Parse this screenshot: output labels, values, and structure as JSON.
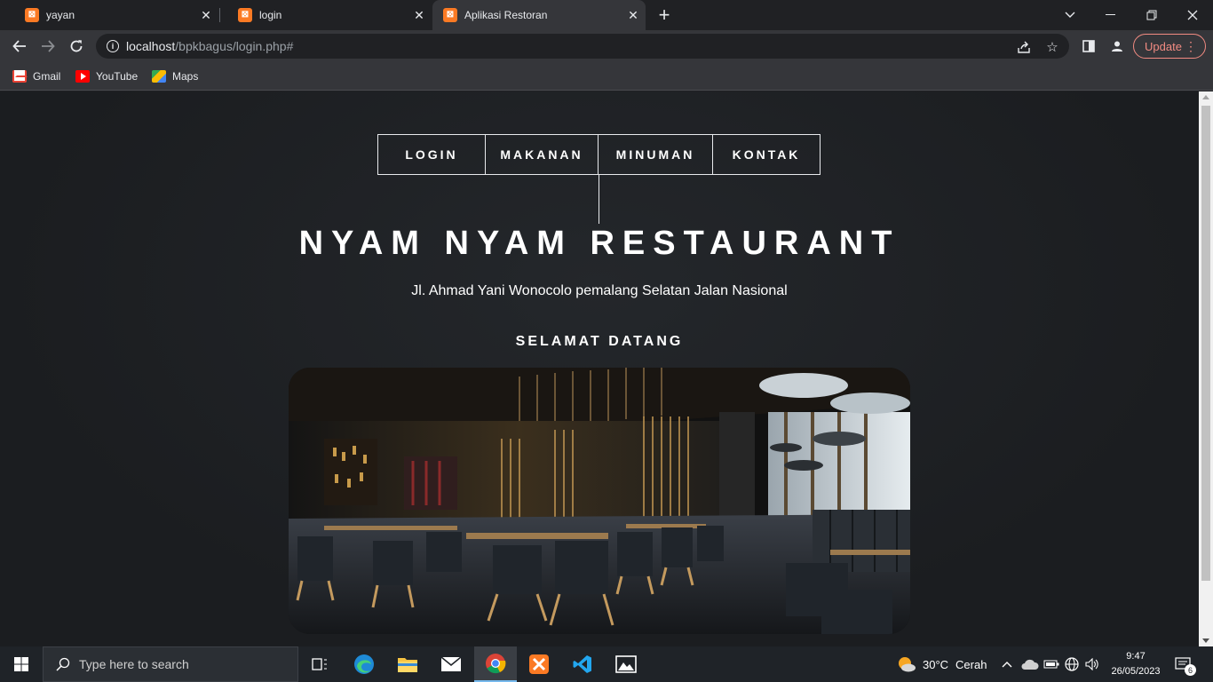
{
  "browser": {
    "tabs": [
      {
        "title": "yayan",
        "active": false
      },
      {
        "title": "login",
        "active": false
      },
      {
        "title": "Aplikasi Restoran",
        "active": true
      }
    ],
    "new_tab_icon": "plus-icon",
    "url_host": "localhost",
    "url_path": "/bpkbagus/login.php#",
    "update_label": "Update",
    "bookmarks": [
      {
        "label": "Gmail",
        "icon": "gmail-icon"
      },
      {
        "label": "YouTube",
        "icon": "youtube-icon"
      },
      {
        "label": "Maps",
        "icon": "maps-icon"
      }
    ]
  },
  "page": {
    "menu": [
      "LOGIN",
      "MAKANAN",
      "MINUMAN",
      "KONTAK"
    ],
    "title": "NYAM NYAM RESTAURANT",
    "address": "Jl. Ahmad Yani Wonocolo pemalang Selatan Jalan Nasional",
    "welcome": "SELAMAT DATANG",
    "hero_image": "restaurant-interior-photo"
  },
  "taskbar": {
    "search_placeholder": "Type here to search",
    "weather_temp": "30°C",
    "weather_text": "Cerah",
    "time": "9:47",
    "date": "26/05/2023",
    "notification_count": "6"
  },
  "colors": {
    "accent_tab_icon": "#fb7a24",
    "update_border": "#f28b82",
    "page_bg": "#1e2023",
    "taskbar_bg": "#1f2328"
  }
}
